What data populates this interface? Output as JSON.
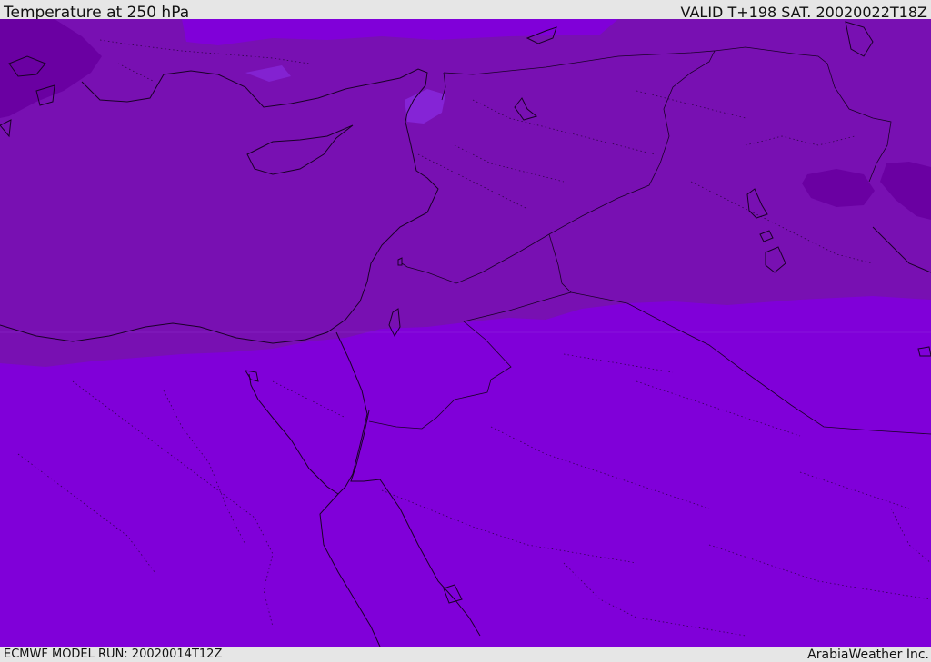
{
  "header": {
    "title": "Temperature at 250 hPa",
    "valid": "VALID T+198 SAT. 20020022T18Z"
  },
  "footer": {
    "model_run": "ECMWF MODEL RUN: 20020014T12Z",
    "credit": "ArabiaWeather Inc."
  },
  "colors": {
    "band_cold_dark": "#6a00a2",
    "band_cold": "#7810b2",
    "band_mid": "#8000d9",
    "band_light_patch": "#8a2ee6",
    "coastline": "#1a0028"
  }
}
